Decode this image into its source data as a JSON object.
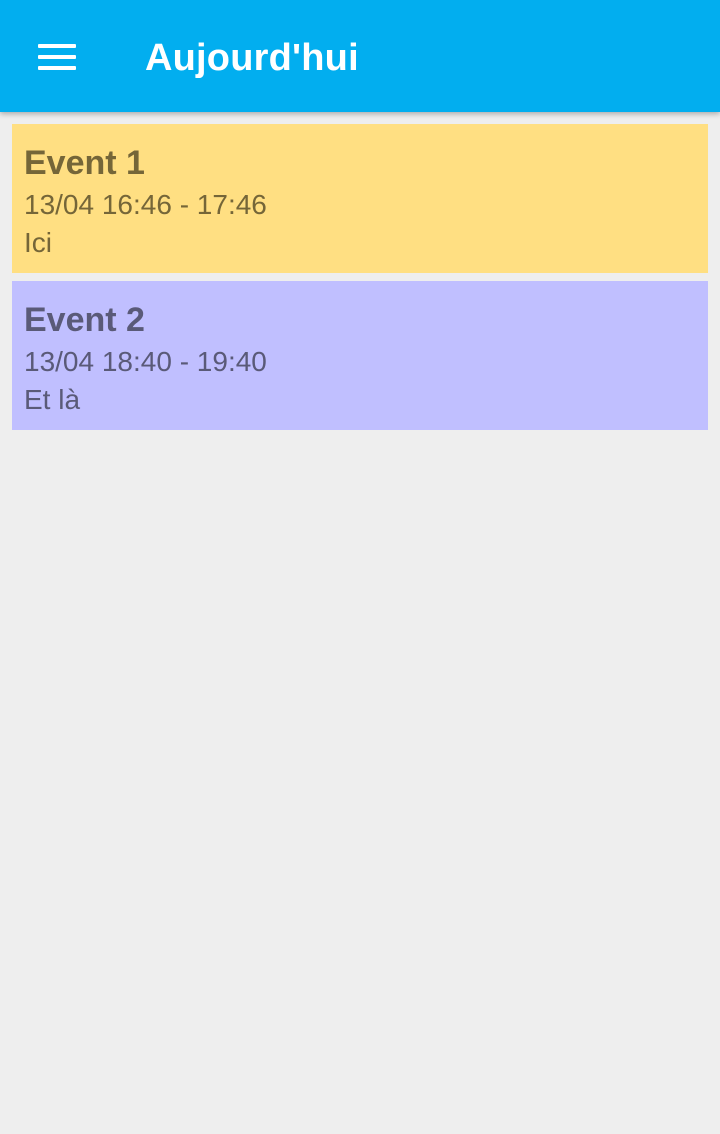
{
  "app_bar": {
    "title": "Aujourd'hui",
    "menu_icon": "hamburger-menu-icon",
    "background_color": "#02aeef"
  },
  "events": [
    {
      "title": "Event 1",
      "time": "13/04 16:46 - 17:46",
      "location": "Ici",
      "background_color": "#ffdf82",
      "text_color": "#756638"
    },
    {
      "title": "Event 2",
      "time": "13/04 18:40 - 19:40",
      "location": "Et là",
      "background_color": "#c0bfff",
      "text_color": "#5a5a78"
    }
  ],
  "page": {
    "background_color": "#eeeeee"
  }
}
